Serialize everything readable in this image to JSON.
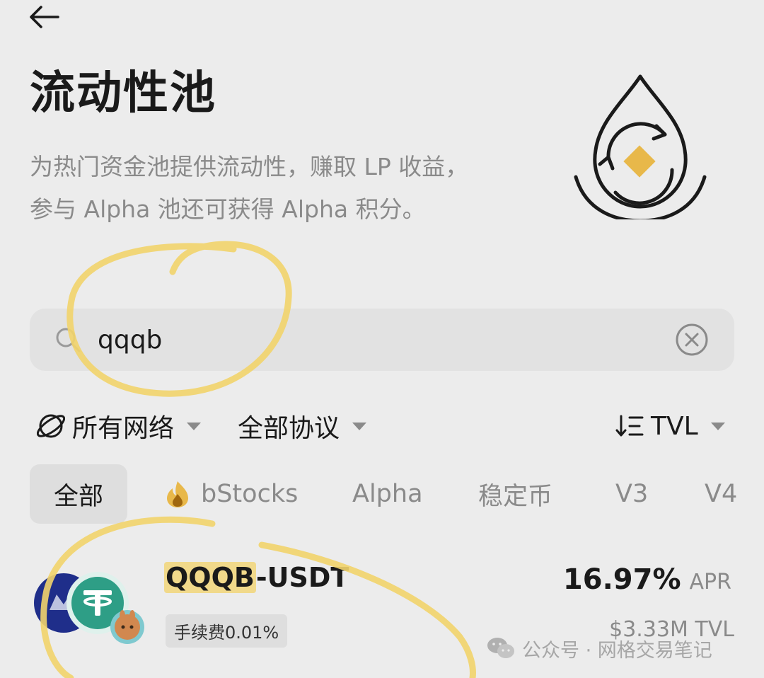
{
  "header": {
    "title": "流动性池",
    "description_line1": "为热门资金池提供流动性，赚取 LP 收益，",
    "description_line2": "参与 Alpha 池还可获得 Alpha 积分。"
  },
  "search": {
    "value": "qqqb",
    "placeholder": ""
  },
  "filters": {
    "network": "所有网络",
    "protocol": "全部协议",
    "sort": "TVL"
  },
  "tabs": [
    {
      "label": "全部",
      "active": true
    },
    {
      "label": "bStocks",
      "active": false
    },
    {
      "label": "Alpha",
      "active": false
    },
    {
      "label": "稳定币",
      "active": false
    },
    {
      "label": "V3",
      "active": false
    },
    {
      "label": "V4",
      "active": false
    }
  ],
  "pools": [
    {
      "pair_highlight": "QQQB",
      "pair_rest": "-USDT",
      "fee": "手续费0.01%",
      "apr_value": "16.97%",
      "apr_label": "APR",
      "tvl": "$3.33M TVL"
    }
  ],
  "watermark": {
    "text": "公众号 · 网格交易笔记"
  },
  "icons": {
    "back": "arrow-left-icon",
    "hero": "liquidity-drop-icon",
    "search": "search-icon",
    "clear": "clear-circle-icon",
    "network": "globe-icon",
    "sort": "sort-icon",
    "hot": "fire-icon"
  },
  "colors": {
    "background": "#ececec",
    "accent_gold": "#e8b84a",
    "highlighter": "#f2d46b",
    "muted_text": "#8a8a8a"
  }
}
